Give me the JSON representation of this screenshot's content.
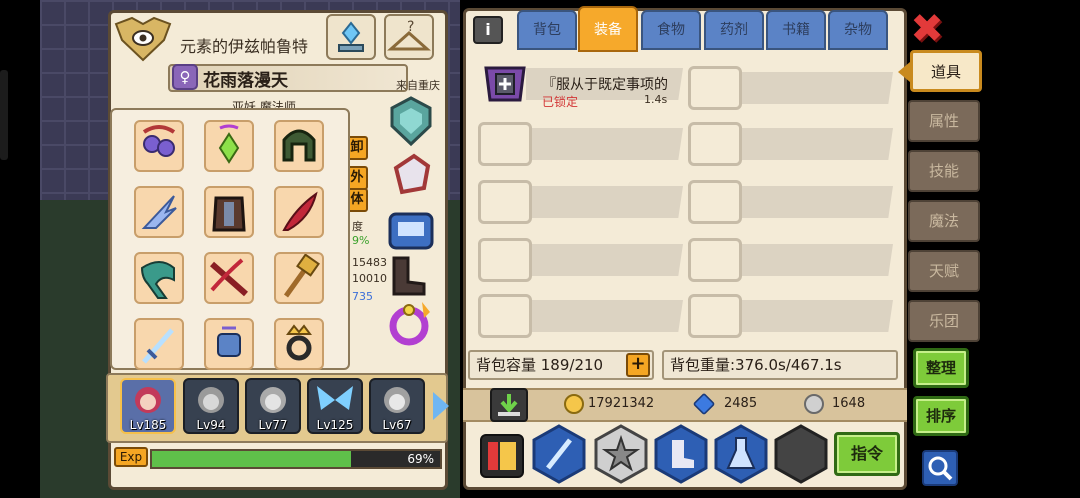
{
  "character": {
    "name": "元素的伊兹帕鲁特",
    "title": "花雨落漫天",
    "title_badge": "♀",
    "origin": "来自重庆",
    "class_text": "亚妖 魔法师",
    "side_badges": [
      "卸",
      "外",
      "体"
    ],
    "side_stats": [
      "度",
      "9%",
      "15483",
      "10010",
      "735"
    ]
  },
  "party": {
    "members": [
      {
        "level": "Lv185",
        "selected": true
      },
      {
        "level": "Lv94",
        "selected": false
      },
      {
        "level": "Lv77",
        "selected": false
      },
      {
        "level": "Lv125",
        "selected": false
      },
      {
        "level": "Lv67",
        "selected": false
      }
    ]
  },
  "exp": {
    "label": "Exp",
    "percent_text": "69%",
    "fraction": 0.69
  },
  "tabs": [
    {
      "label": "背包",
      "active": false
    },
    {
      "label": "装备",
      "active": true
    },
    {
      "label": "食物",
      "active": false
    },
    {
      "label": "药剂",
      "active": false
    },
    {
      "label": "书籍",
      "active": false
    },
    {
      "label": "杂物",
      "active": false
    }
  ],
  "info_button": "i",
  "close_button": "✖",
  "bag": {
    "first_item": {
      "name": "『服从于既定事项的",
      "lock": "已锁定",
      "time": "1.4s"
    },
    "capacity_text": "背包容量 189/210",
    "weight_text": "背包重量:376.0s/467.1s"
  },
  "currency": {
    "gold": "17921342",
    "diamond": "2485",
    "silver": "1648"
  },
  "command_button": "指令",
  "side_nav": [
    "道具",
    "属性",
    "技能",
    "魔法",
    "天赋",
    "乐团"
  ],
  "side_actions": {
    "sort_label": "整理",
    "order_label": "排序"
  },
  "colors": {
    "accent_orange": "#f6a92b",
    "tab_blue": "#5b83c6",
    "green_button": "#7ecb3a",
    "close_red": "#e23a3a"
  }
}
